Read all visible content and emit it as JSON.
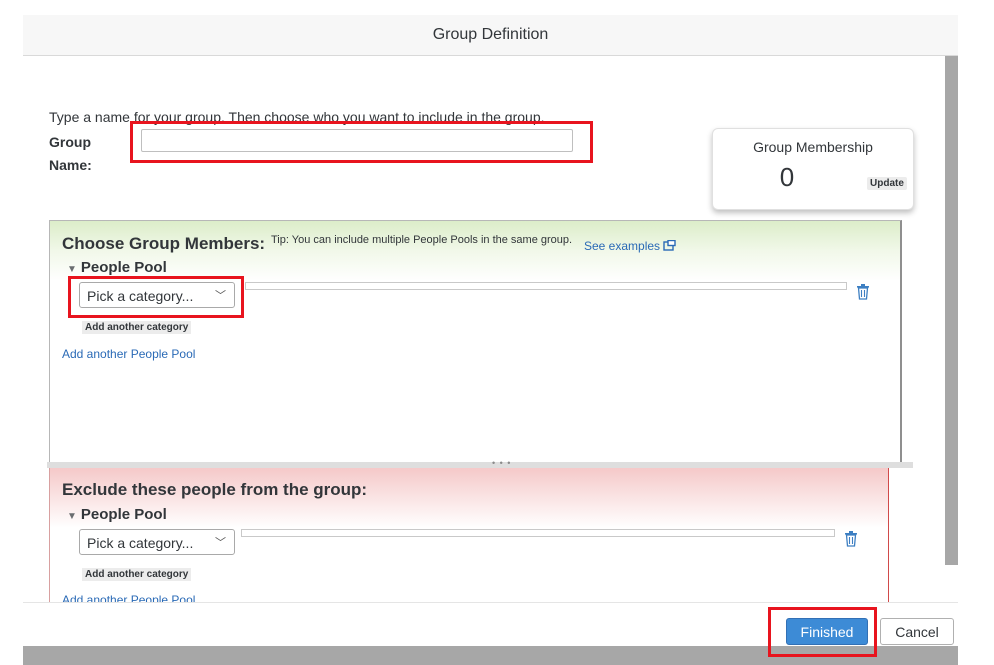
{
  "dialog": {
    "title": "Group Definition"
  },
  "intro": "Type a name for your group. Then choose who you want to include in the group.",
  "group_name": {
    "label_line1": "Group",
    "label_line2": "Name:",
    "value": ""
  },
  "membership": {
    "title": "Group Membership",
    "count": "0",
    "update_label": "Update"
  },
  "include": {
    "heading": "Choose Group Members:",
    "tip": "Tip: You can include multiple People Pools in the same group.",
    "see_examples": "See examples",
    "pool_label": "People Pool",
    "category_select": "Pick a category...",
    "add_category": "Add another category",
    "add_pool": "Add another People Pool"
  },
  "exclude": {
    "heading": "Exclude these people from the group:",
    "pool_label": "People Pool",
    "category_select": "Pick a category...",
    "add_category": "Add another category",
    "add_pool": "Add another People Pool"
  },
  "footer": {
    "finished_label": "Finished",
    "cancel_label": "Cancel"
  },
  "colors": {
    "accent": "#3d8bd6",
    "highlight": "#e8141e",
    "link": "#2a6ab6"
  }
}
